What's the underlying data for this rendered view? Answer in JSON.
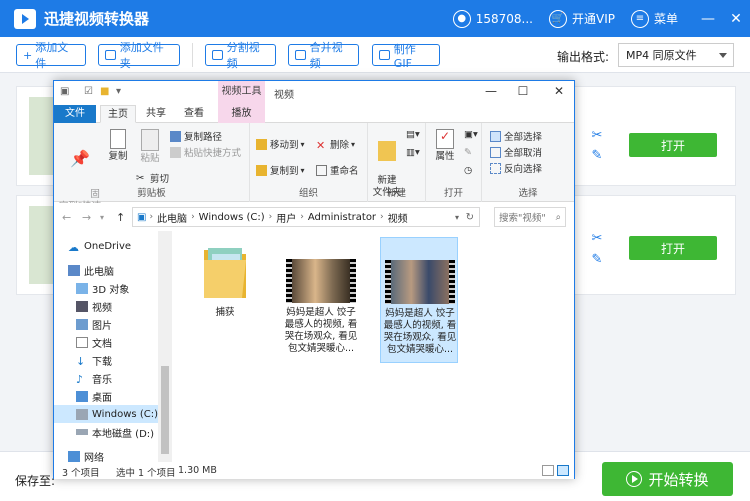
{
  "app": {
    "title": "迅捷视频转换器",
    "user_id": "158708...",
    "vip_label": "开通VIP",
    "menu_label": "菜单",
    "accent": "#1e7be6",
    "green": "#3eb734"
  },
  "toolbar": {
    "add_file": "添加文件",
    "add_folder": "添加文件夹",
    "split_video": "分割视频",
    "merge_video": "合并视频",
    "make_gif": "制作GIF",
    "output_format_label": "输出格式:",
    "output_format_value": "MP4  同原文件"
  },
  "rows": [
    {
      "open_label": "打开"
    },
    {
      "open_label": "打开"
    }
  ],
  "bottom": {
    "save_to_label": "保存至:",
    "start_label": "开始转换"
  },
  "explorer": {
    "context_tab": "视频工具",
    "window_title": "视频",
    "tabs": [
      "文件",
      "主页",
      "共享",
      "查看",
      "播放"
    ],
    "ribbon": {
      "pin_quick_access": "固定到\"快速访问\"",
      "copy": "复制",
      "paste": "粘贴",
      "copy_path": "复制路径",
      "paste_shortcut": "粘贴快捷方式",
      "cut": "剪切",
      "clipboard_group": "剪贴板",
      "move_to": "移动到",
      "copy_to": "复制到",
      "delete": "删除",
      "rename": "重命名",
      "organize_group": "组织",
      "new_folder": "新建\n文件夹",
      "new_group": "新建",
      "properties": "属性",
      "open_group": "打开",
      "select_all": "全部选择",
      "select_none": "全部取消",
      "invert_selection": "反向选择",
      "select_group": "选择"
    },
    "address": [
      "此电脑",
      "Windows (C:)",
      "用户",
      "Administrator",
      "视频"
    ],
    "search_placeholder": "搜索\"视频\"",
    "nav_items": [
      "OneDrive",
      "此电脑",
      "3D 对象",
      "视频",
      "图片",
      "文档",
      "下载",
      "音乐",
      "桌面",
      "Windows (C:)",
      "本地磁盘 (D:)",
      "网络"
    ],
    "files": [
      {
        "name": "捕获",
        "type": "folder"
      },
      {
        "name": "妈妈是超人 饺子最感人的视频, 看哭在场观众, 看见包文婧哭暖心...",
        "type": "video"
      },
      {
        "name": "妈妈是超人 饺子最感人的视频, 看哭在场观众, 看见包文婧哭暖心...",
        "type": "video"
      }
    ],
    "status": {
      "count": "3 个项目",
      "selected": "选中 1 个项目",
      "size": "1.30 MB"
    }
  }
}
